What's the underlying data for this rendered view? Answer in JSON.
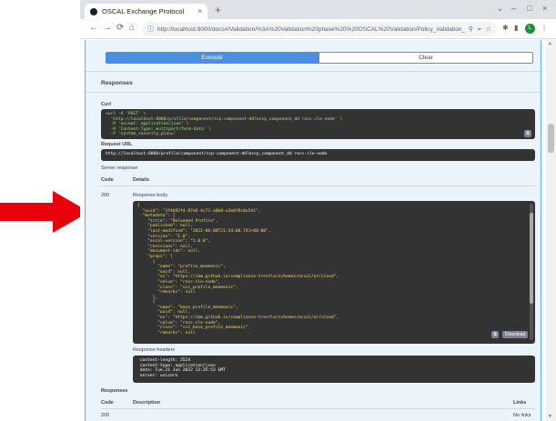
{
  "browser": {
    "tab_title": "OSCAL Exchange Protocol",
    "tab_close": "×",
    "new_tab": "+",
    "url": "http://localhost:8000/docs#/Validation/%3A%20Validation%20phase%20%20OSCAL%20Validation/Policy_Validation_Point_ch...",
    "nav": {
      "back": "←",
      "forward": "→",
      "reload": "⟳",
      "home": "⌂"
    },
    "window_controls": {
      "chevron": "⌄",
      "minimize": "–",
      "maximize": "□",
      "close": "×"
    },
    "profile_initial": "L"
  },
  "execute": {
    "execute_label": "Execute",
    "clear_label": "Clear"
  },
  "responses_section": {
    "title": "Responses"
  },
  "curl": {
    "label": "Curl",
    "lines": [
      "curl -X 'POST' \\",
      "  'http://localhost:8000/profile/component/scp-component-dd?oscp_component_dd rocc-cle-node' \\",
      "  -H 'accept: application/json' \\",
      "  -H 'Content-Type: multipart/form-data' \\",
      "  -F 'system_security_plan='"
    ]
  },
  "request_url": {
    "label": "Request URL",
    "value": "http://localhost:8000/profile/component/scp-component-dd?oscp_component_dd rocc-cle-node"
  },
  "server_response": {
    "label": "Server response",
    "code_header": "Code",
    "details_header": "Details",
    "code": "200",
    "body_label": "Response body",
    "body_lines": [
      "{",
      "  \"uuid\": \"3f4b92f4-07e6-4c71-a0b8-a2e8f9c0e5d1\",",
      "  \"metadata\": {",
      "    \"title\": \"Reloaded Profile\",",
      "    \"published\": null,",
      "    \"last-modified\": \"2022-06-08T21:34:08.741+00:00\",",
      "    \"version\": \"1.0\",",
      "    \"oscal-version\": \"1.0.0\",",
      "    \"revisions\": null,",
      "    \"document-ids\": null,",
      "    \"props\": [",
      "      {",
      "        \"name\": \"profile_mnemonic\",",
      "        \"uuid\": null,",
      "        \"ns\": \"https://ibm.github.io/compliance-trestle/schemas/oscal/ar/cloud\",",
      "        \"value\": \"rocc-cle-node\",",
      "        \"class\": \"scc_profile_mnemonic\",",
      "        \"remarks\": null",
      "      },",
      "      {",
      "        \"name\": \"base_profile_mnemonic\",",
      "        \"uuid\": null,",
      "        \"ns\": \"https://ibm.github.io/compliance-trestle/schemas/oscal/ar/cloud\",",
      "        \"value\": \"rocc-cle-node\",",
      "        \"class\": \"scc_base_profile_mnemonic\",",
      "        \"remarks\": null"
    ],
    "download_label": "Download",
    "headers_label": "Response headers",
    "header_lines": [
      " content-length: 3524",
      " content-type: application/json",
      " date: Tue,21 Jun 2022 12:35:53 GMT",
      " server: uvicorn"
    ]
  },
  "responses_table": {
    "title": "Responses",
    "code_header": "Code",
    "description_header": "Description",
    "links_header": "Links",
    "row_code": "200",
    "row_links": "No links"
  },
  "colors": {
    "execute_blue": "#4990e2",
    "panel_bg": "#ebf3fb",
    "code_bg": "#333333",
    "arrow_red": "#e8000b"
  }
}
